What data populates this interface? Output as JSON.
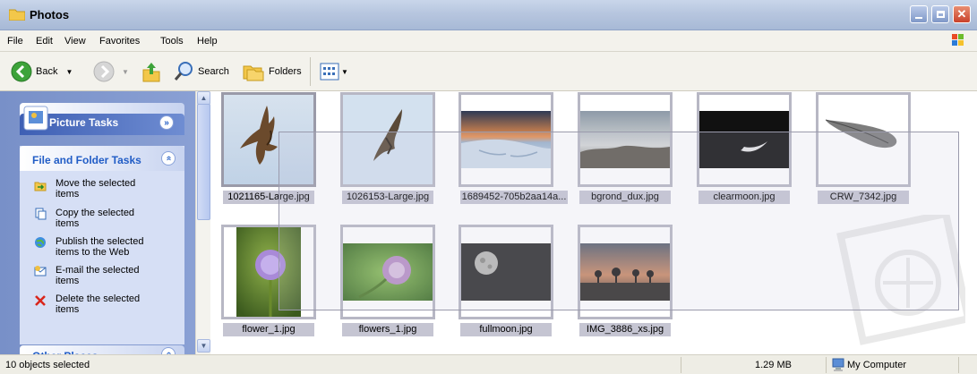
{
  "window": {
    "title": "Photos"
  },
  "menu": [
    "File",
    "Edit",
    "View",
    "Favorites",
    "Tools",
    "Help"
  ],
  "toolbar": {
    "back": "Back",
    "search": "Search",
    "folders": "Folders"
  },
  "taskpane": {
    "picture_tasks": "Picture Tasks",
    "file_folder_tasks": "File and Folder Tasks",
    "tasks": [
      {
        "line1": "Move the selected",
        "line2": "items",
        "icon": "move-icon"
      },
      {
        "line1": "Copy the selected",
        "line2": "items",
        "icon": "copy-icon"
      },
      {
        "line1": "Publish the selected",
        "line2": "items to the Web",
        "icon": "publish-web-icon"
      },
      {
        "line1": "E-mail the selected",
        "line2": "items",
        "icon": "email-icon"
      },
      {
        "line1": "Delete the selected",
        "line2": "items",
        "icon": "delete-icon"
      }
    ],
    "other_places": "Other Places"
  },
  "files": [
    {
      "name": "1021165-Large.jpg"
    },
    {
      "name": "1026153-Large.jpg"
    },
    {
      "name": "1689452-705b2aa14a..."
    },
    {
      "name": "bgrond_dux.jpg"
    },
    {
      "name": "clearmoon.jpg"
    },
    {
      "name": "CRW_7342.jpg"
    },
    {
      "name": "flower_1.jpg"
    },
    {
      "name": "flowers_1.jpg"
    },
    {
      "name": "fullmoon.jpg"
    },
    {
      "name": "IMG_3886_xs.jpg"
    }
  ],
  "status": {
    "selected": "10 objects selected",
    "size": "1.29 MB",
    "location": "My Computer"
  },
  "colors": {
    "selection_caption": "#c5c5d2",
    "taskpane_bg": "#7f96cc",
    "link": "#215dc6"
  }
}
